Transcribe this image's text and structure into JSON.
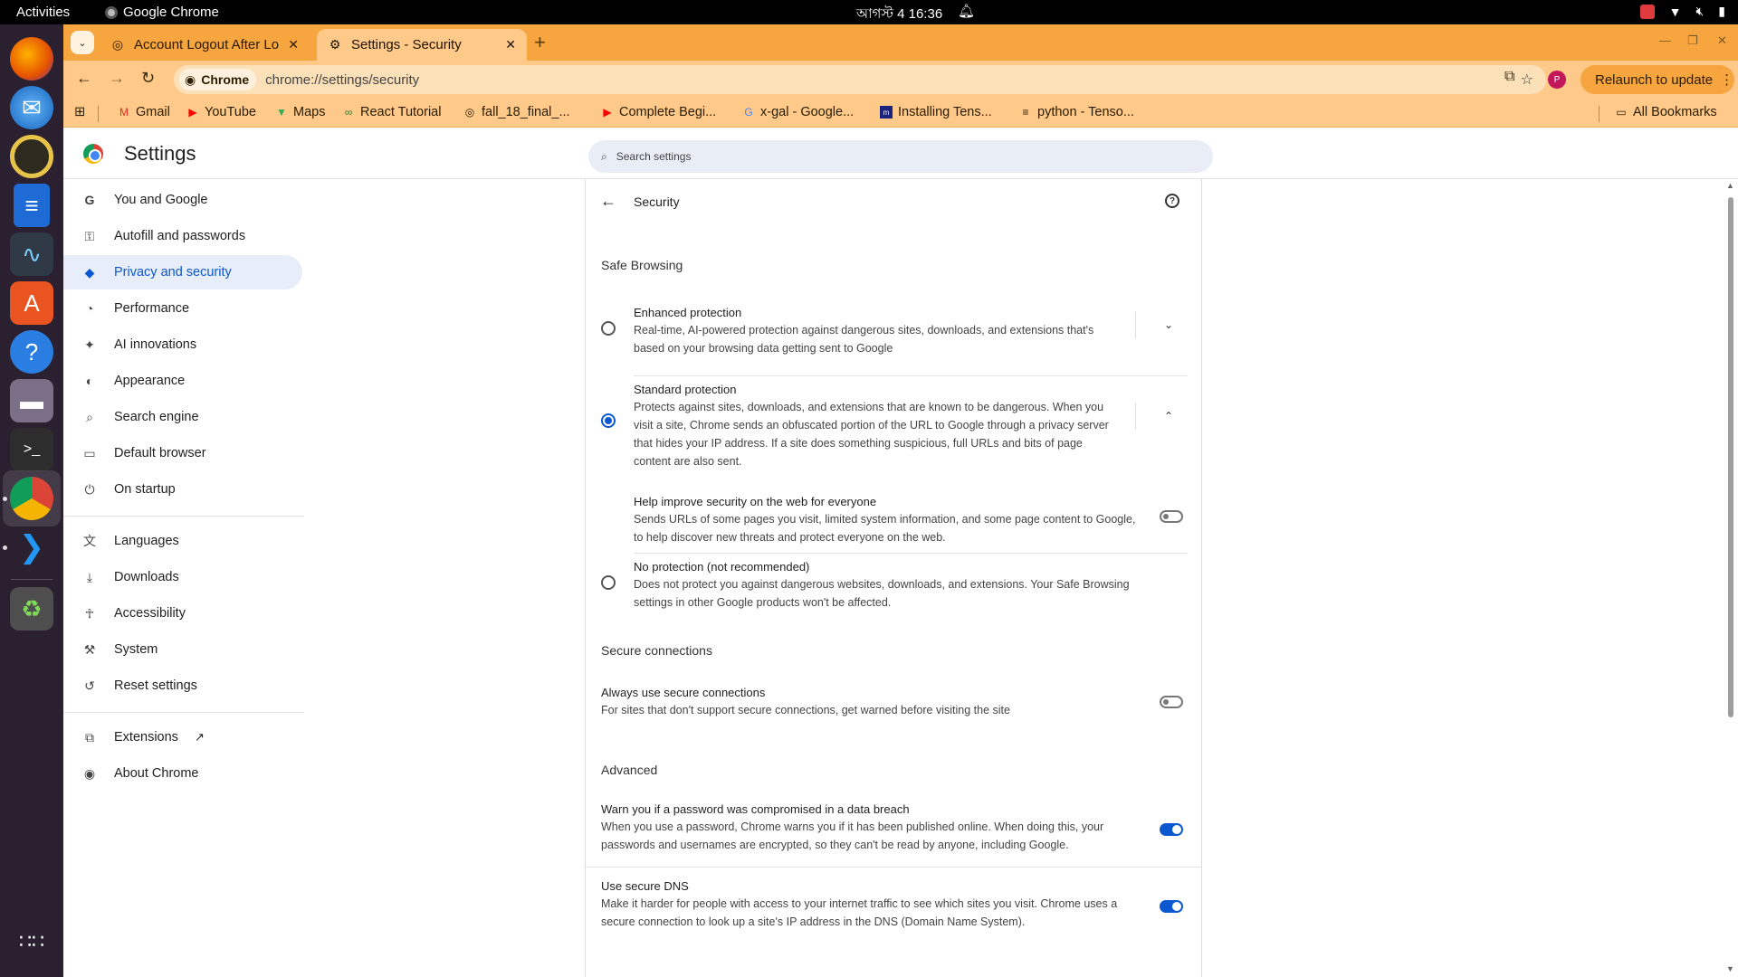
{
  "topbar": {
    "activities": "Activities",
    "app_name": "Google Chrome",
    "clock": "আগস্ট 4  16:36"
  },
  "dock": {
    "items": [
      "firefox-icon",
      "thunderbird-icon",
      "rhythmbox-icon",
      "writer-icon",
      "system-monitor-icon",
      "app-center-icon",
      "help-icon",
      "files-icon",
      "terminal-icon",
      "chrome-icon",
      "vscode-icon",
      "trash-icon",
      "show-apps-icon"
    ]
  },
  "tabs": [
    {
      "title": "Account Logout After Lo",
      "active": false
    },
    {
      "title": "Settings - Security",
      "active": true
    }
  ],
  "toolbar": {
    "chip": "Chrome",
    "url": "chrome://settings/security",
    "relaunch": "Relaunch to update",
    "avatar": "P"
  },
  "bookmarks": [
    "Gmail",
    "YouTube",
    "Maps",
    "React Tutorial",
    "fall_18_final_...",
    "Complete Begi...",
    "x-gal - Google...",
    "Installing Tens...",
    "python - Tenso...",
    "All Bookmarks"
  ],
  "settings": {
    "title": "Settings",
    "search_placeholder": "Search settings",
    "nav": [
      {
        "label": "You and Google",
        "icon": "google-icon"
      },
      {
        "label": "Autofill and passwords",
        "icon": "key-icon"
      },
      {
        "label": "Privacy and security",
        "icon": "shield-icon",
        "selected": true
      },
      {
        "label": "Performance",
        "icon": "gauge-icon"
      },
      {
        "label": "AI innovations",
        "icon": "sparkle-icon"
      },
      {
        "label": "Appearance",
        "icon": "palette-icon"
      },
      {
        "label": "Search engine",
        "icon": "search-icon"
      },
      {
        "label": "Default browser",
        "icon": "browser-icon"
      },
      {
        "label": "On startup",
        "icon": "power-icon"
      },
      {
        "label": "Languages",
        "icon": "translate-icon"
      },
      {
        "label": "Downloads",
        "icon": "download-icon"
      },
      {
        "label": "Accessibility",
        "icon": "accessibility-icon"
      },
      {
        "label": "System",
        "icon": "wrench-icon"
      },
      {
        "label": "Reset settings",
        "icon": "reset-icon"
      },
      {
        "label": "Extensions",
        "icon": "puzzle-icon"
      },
      {
        "label": "About Chrome",
        "icon": "chrome-icon"
      }
    ],
    "page_title": "Security",
    "safe_browsing": {
      "heading": "Safe Browsing",
      "enhanced": {
        "title": "Enhanced protection",
        "desc": "Real-time, AI-powered protection against dangerous sites, downloads, and extensions that's based on your browsing data getting sent to Google",
        "selected": false
      },
      "standard": {
        "title": "Standard protection",
        "desc": "Protects against sites, downloads, and extensions that are known to be dangerous. When you visit a site, Chrome sends an obfuscated portion of the URL to Google through a privacy server that hides your IP address. If a site does something suspicious, full URLs and bits of page content are also sent.",
        "selected": true
      },
      "help_improve": {
        "title": "Help improve security on the web for everyone",
        "desc": "Sends URLs of some pages you visit, limited system information, and some page content to Google, to help discover new threats and protect everyone on the web.",
        "enabled": false
      },
      "none": {
        "title": "No protection (not recommended)",
        "desc": "Does not protect you against dangerous websites, downloads, and extensions. Your Safe Browsing settings in other Google products won't be affected.",
        "selected": false
      }
    },
    "secure_connections": {
      "heading": "Secure connections",
      "always_secure": {
        "title": "Always use secure connections",
        "desc": "For sites that don't support secure connections, get warned before visiting the site",
        "enabled": false
      }
    },
    "advanced": {
      "heading": "Advanced",
      "breach_warning": {
        "title": "Warn you if a password was compromised in a data breach",
        "desc": "When you use a password, Chrome warns you if it has been published online. When doing this, your passwords and usernames are encrypted, so they can't be read by anyone, including Google.",
        "enabled": true
      },
      "secure_dns": {
        "title": "Use secure DNS",
        "desc": "Make it harder for people with access to your internet traffic to see which sites you visit. Chrome uses a secure connection to look up a site's IP address in the DNS (Domain Name System).",
        "enabled": true
      }
    }
  },
  "colors": {
    "tabstrip": "#f7a53f",
    "toolbar": "#ffc98a",
    "accent": "#0b57d0",
    "nav_selected_bg": "#e8eef9"
  }
}
